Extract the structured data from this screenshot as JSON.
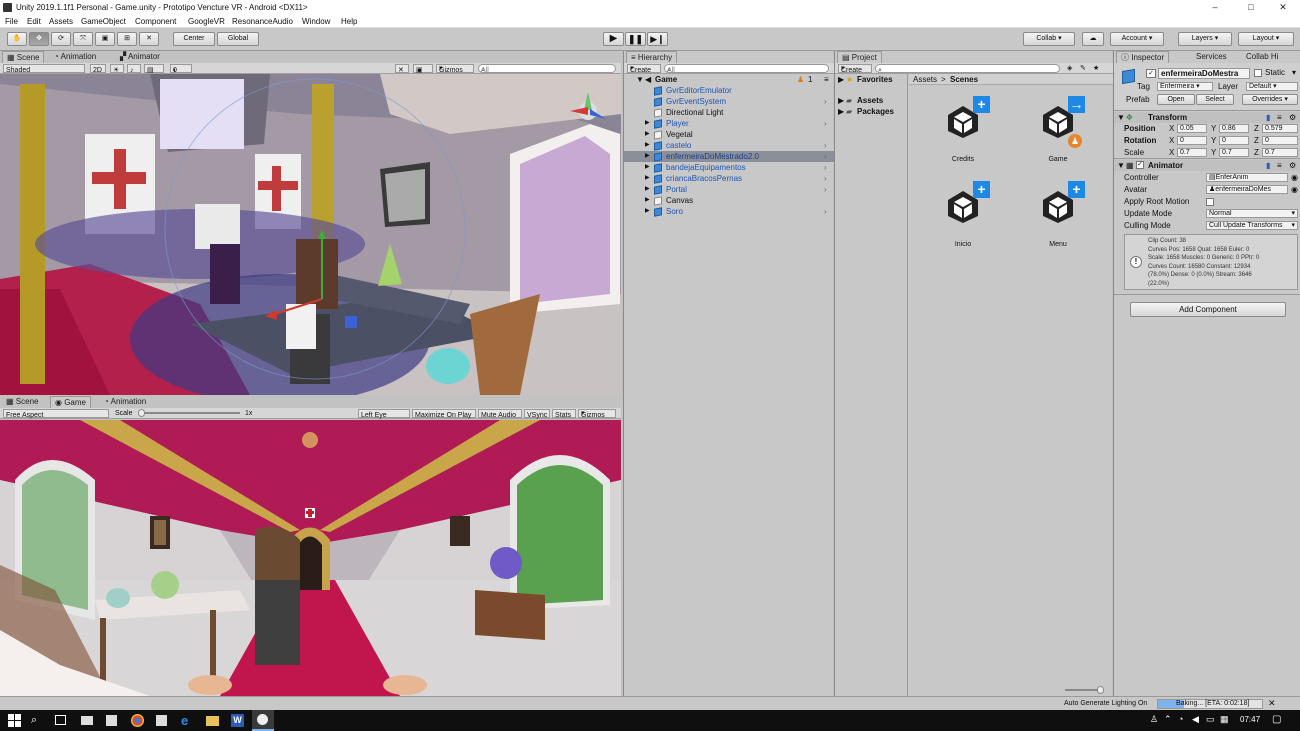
{
  "window": {
    "title": "Unity 2019.1.1f1 Personal - Game.unity - Prototipo Vencture VR - Android <DX11>",
    "controls": [
      "–",
      "□",
      "✕"
    ]
  },
  "menu": [
    "File",
    "Edit",
    "Assets",
    "GameObject",
    "Component",
    "GoogleVR",
    "ResonanceAudio",
    "Window",
    "Help"
  ],
  "toolbar": {
    "pivot": "Center",
    "space": "Global",
    "collab": "Collab ▾",
    "account": "Account",
    "layers": "Layers",
    "layout": "Layout"
  },
  "scene_panel": {
    "tabs": [
      "Scene",
      "Animation",
      "Animator"
    ],
    "shading": "Shaded",
    "mode_2d": "2D",
    "fx_count": "0",
    "gizmos": "Gizmos",
    "search": "All"
  },
  "game_panel": {
    "tabs": [
      "Scene",
      "Game",
      "Animation"
    ],
    "aspect": "Free Aspect",
    "scale_label": "Scale",
    "scale_value": "1x",
    "eye": "Left Eye",
    "maximize": "Maximize On Play",
    "mute": "Mute Audio",
    "vsync": "VSync",
    "stats": "Stats",
    "gizmos": "Gizmos"
  },
  "hierarchy": {
    "tab": "Hierarchy",
    "create": "Create",
    "search": "All",
    "scene": "Game",
    "user_count": "1",
    "items": [
      {
        "label": "GvrEditorEmulator",
        "prefab": true,
        "arrow": false,
        "expander": false
      },
      {
        "label": "GvrEventSystem",
        "prefab": true,
        "arrow": true,
        "expander": false
      },
      {
        "label": "Directional Light",
        "prefab": false,
        "arrow": false,
        "expander": false
      },
      {
        "label": "Player",
        "prefab": true,
        "arrow": true,
        "expander": true
      },
      {
        "label": "Vegetal",
        "prefab": false,
        "arrow": false,
        "expander": true
      },
      {
        "label": "castelo",
        "prefab": true,
        "arrow": true,
        "expander": true
      },
      {
        "label": "enfermeiraDoMestrado2.0",
        "prefab": true,
        "arrow": true,
        "expander": true,
        "selected": true
      },
      {
        "label": "bandejaEquipamentos",
        "prefab": true,
        "arrow": true,
        "expander": true
      },
      {
        "label": "criancaBracosPernas",
        "prefab": true,
        "arrow": true,
        "expander": true
      },
      {
        "label": "Portal",
        "prefab": true,
        "arrow": true,
        "expander": true
      },
      {
        "label": "Canvas",
        "prefab": false,
        "arrow": false,
        "expander": true
      },
      {
        "label": "Soro",
        "prefab": true,
        "arrow": true,
        "expander": true
      }
    ]
  },
  "project": {
    "tab": "Project",
    "create": "Create",
    "favorites": "Favorites",
    "assets": "Assets",
    "packages": "Packages",
    "breadcrumb": [
      "Assets",
      "Scenes"
    ],
    "scenes": [
      {
        "name": "Credits",
        "badge": "plus"
      },
      {
        "name": "Game",
        "badge": "arrow"
      },
      {
        "name": "Inicio",
        "badge": "plus"
      },
      {
        "name": "Menu",
        "badge": "plus"
      }
    ]
  },
  "inspector": {
    "tabs": [
      "Inspector",
      "Services",
      "Collab Hi"
    ],
    "object_name": "enfermeiraDoMestra",
    "static": "Static",
    "tag_label": "Tag",
    "tag": "Enfermeira",
    "layer_label": "Layer",
    "layer": "Default",
    "prefab_label": "Prefab",
    "prefab_buttons": [
      "Open",
      "Select",
      "Overrides"
    ],
    "transform": {
      "title": "Transform",
      "position": {
        "label": "Position",
        "x": "0.05",
        "y": "0.86",
        "z": "0.579"
      },
      "rotation": {
        "label": "Rotation",
        "x": "0",
        "y": "0",
        "z": "0"
      },
      "scale": {
        "label": "Scale",
        "x": "0.7",
        "y": "0.7",
        "z": "0.7"
      }
    },
    "animator": {
      "title": "Animator",
      "controller_label": "Controller",
      "controller": "EnferAnim",
      "avatar_label": "Avatar",
      "avatar": "enfermeiraDoMes",
      "root_motion_label": "Apply Root Motion",
      "update_mode_label": "Update Mode",
      "update_mode": "Normal",
      "culling_label": "Culling Mode",
      "culling": "Cull Update Transforms",
      "info": [
        "Clip Count: 38",
        "Curves Pos: 1658 Quat: 1658 Euler: 0",
        "Scale: 1658 Muscles: 0 Generic: 0 PPtr: 0",
        "Curves Count: 16580 Constant: 12934",
        "(78.0%) Dense: 0 (0.0%) Stream: 3646",
        "(22.0%)"
      ]
    },
    "add_component": "Add Component"
  },
  "statusbar": {
    "auto_lighting": "Auto Generate Lighting On",
    "baking": "Baking... [ETA: 0:02:18]",
    "baking_progress": 0.25
  },
  "taskbar": {
    "time": "07:47"
  },
  "colors": {
    "selection": "#8a8f9a",
    "prefab_text": "#1d55b8",
    "accent_blue": "#2e8fe0",
    "carpet": "#9a1040",
    "ceiling": "#b01a55",
    "unity_badge": "#1e88e5"
  }
}
